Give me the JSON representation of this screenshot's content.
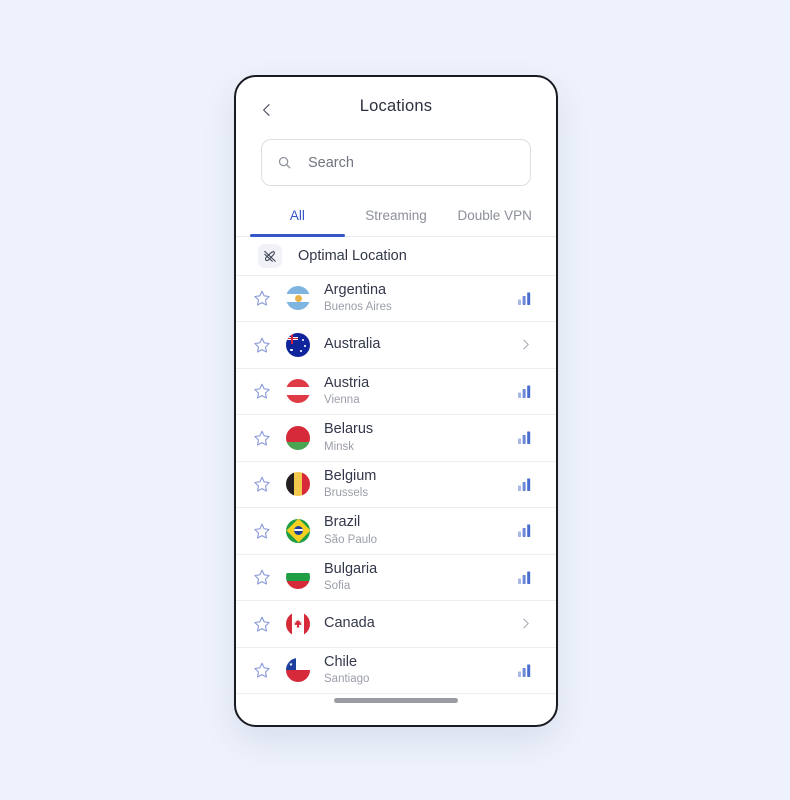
{
  "theme": {
    "page_background": "#eef2fc",
    "card_background": "#ffffff",
    "accent": "#3556c8",
    "title_color": "#2c2f3e",
    "muted_color": "#9a9ea8",
    "border_color": "#1a1a22"
  },
  "header": {
    "back_icon": "chevron-left-icon",
    "title": "Locations"
  },
  "search": {
    "icon": "search-icon",
    "placeholder": "Search",
    "value": ""
  },
  "tabs": [
    {
      "label": "All",
      "active": true
    },
    {
      "label": "Streaming",
      "active": false
    },
    {
      "label": "Double VPN",
      "active": false
    }
  ],
  "optimal": {
    "icon": "rocket-off-icon",
    "label": "Optimal Location"
  },
  "locations": [
    {
      "country": "Argentina",
      "city": "Buenos Aires",
      "favorite": false,
      "star_icon": "star-outline-icon",
      "trailing": "signal-icon",
      "flag": "argentina"
    },
    {
      "country": "Australia",
      "city": "",
      "favorite": false,
      "star_icon": "star-outline-icon",
      "trailing": "chevron-right-icon",
      "flag": "australia"
    },
    {
      "country": "Austria",
      "city": "Vienna",
      "favorite": false,
      "star_icon": "star-outline-icon",
      "trailing": "signal-icon",
      "flag": "austria"
    },
    {
      "country": "Belarus",
      "city": "Minsk",
      "favorite": false,
      "star_icon": "star-outline-icon",
      "trailing": "signal-icon",
      "flag": "belarus"
    },
    {
      "country": "Belgium",
      "city": "Brussels",
      "favorite": false,
      "star_icon": "star-outline-icon",
      "trailing": "signal-icon",
      "flag": "belgium"
    },
    {
      "country": "Brazil",
      "city": "São Paulo",
      "favorite": false,
      "star_icon": "star-outline-icon",
      "trailing": "signal-icon",
      "flag": "brazil"
    },
    {
      "country": "Bulgaria",
      "city": "Sofia",
      "favorite": false,
      "star_icon": "star-outline-icon",
      "trailing": "signal-icon",
      "flag": "bulgaria"
    },
    {
      "country": "Canada",
      "city": "",
      "favorite": false,
      "star_icon": "star-outline-icon",
      "trailing": "chevron-right-icon",
      "flag": "canada"
    },
    {
      "country": "Chile",
      "city": "Santiago",
      "favorite": false,
      "star_icon": "star-outline-icon",
      "trailing": "signal-icon",
      "flag": "chile"
    }
  ]
}
